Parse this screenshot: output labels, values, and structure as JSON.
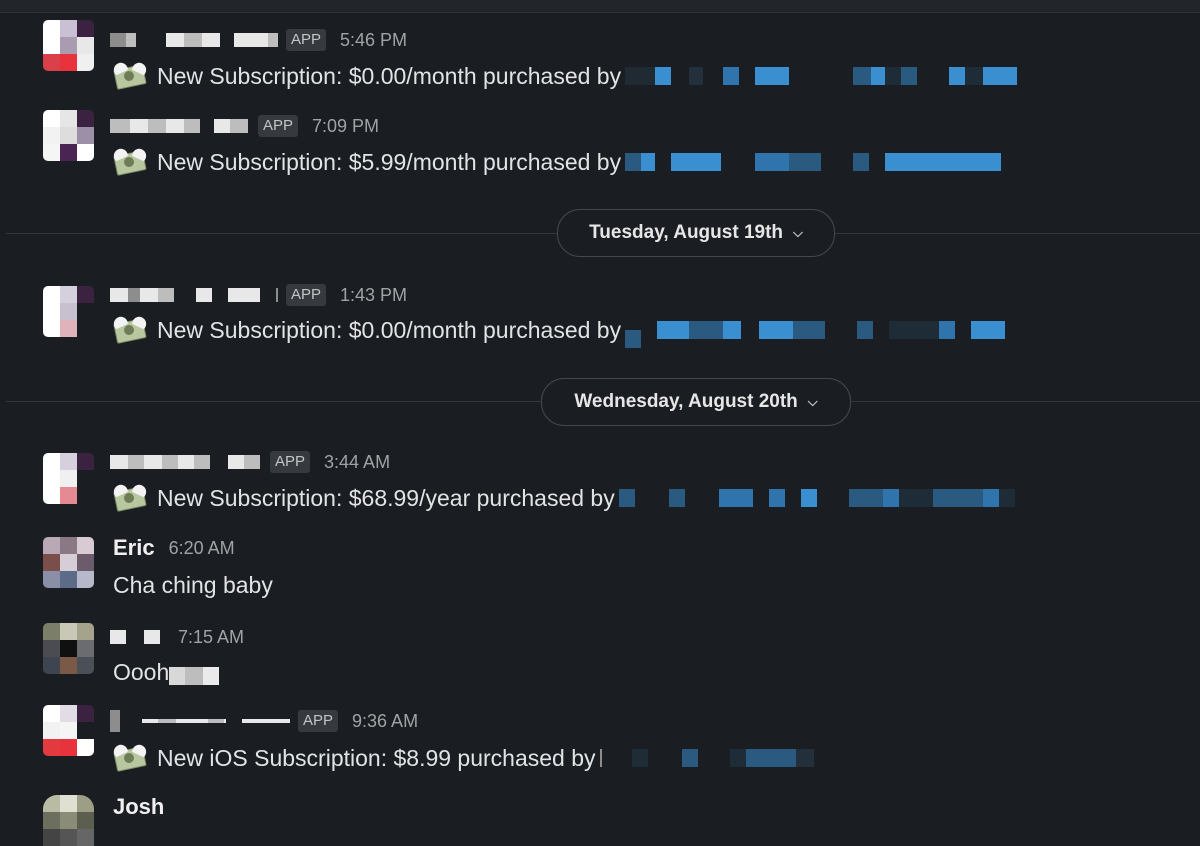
{
  "messages": [
    {
      "app_badge": "APP",
      "time": "5:46 PM",
      "text": "New Subscription: $0.00/month purchased by"
    },
    {
      "app_badge": "APP",
      "time": "7:09 PM",
      "text": "New Subscription: $5.99/month purchased by"
    },
    {
      "app_badge": "APP",
      "time": "1:43 PM",
      "text": "New Subscription: $0.00/month purchased by"
    },
    {
      "app_badge": "APP",
      "time": "3:44 AM",
      "text": "New Subscription: $68.99/year purchased by"
    },
    {
      "sender": "Eric",
      "time": "6:20 AM",
      "text": "Cha ching baby"
    },
    {
      "time": "7:15 AM",
      "text": "Oooh"
    },
    {
      "app_badge": "APP",
      "time": "9:36 AM",
      "text": "New iOS Subscription: $8.99 purchased by"
    },
    {
      "sender": "Josh"
    }
  ],
  "date_dividers": [
    {
      "label": "Tuesday, August 19th",
      "chevron": "chevron-down-icon"
    },
    {
      "label": "Wednesday, August 20th",
      "chevron": "chevron-down-icon"
    }
  ],
  "colors": {
    "background": "#1a1d21",
    "link_redacted": "#3a8fd1",
    "text": "#e2e3e4",
    "muted": "#a1a2a4"
  }
}
